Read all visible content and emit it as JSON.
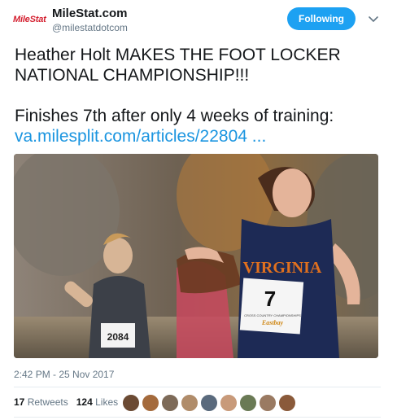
{
  "header": {
    "logo_text": "MileStat",
    "name": "MileStat.com",
    "handle": "@milestatdotcom",
    "follow_label": "Following"
  },
  "tweet": {
    "line1": "Heather Holt MAKES THE FOOT LOCKER",
    "line2": "NATIONAL CHAMPIONSHIP!!!",
    "line3": "Finishes 7th after only 4 weeks of training:",
    "link_text": "va.milesplit.com/articles/22804  ...",
    "timestamp": "2:42 PM - 25 Nov 2017"
  },
  "photo": {
    "jersey_text": "VIRGINIA",
    "bib_number": "7",
    "bib_text": "CROSS COUNTRY CHAMPIONSHIPS",
    "bib_brand": "Eastbay",
    "back_bib_number": "2084"
  },
  "stats": {
    "retweets_count": "17",
    "retweets_label": "Retweets",
    "likes_count": "124",
    "likes_label": "Likes"
  },
  "colors": {
    "accent": "#1da1f2",
    "link": "#1b95e0",
    "brand_red": "#d41f2f"
  }
}
